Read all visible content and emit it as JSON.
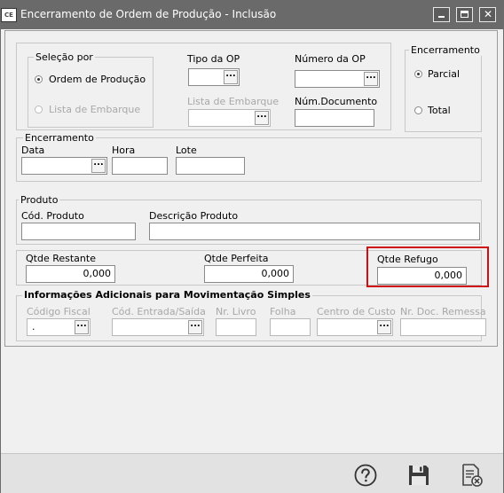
{
  "window": {
    "app_icon": "CE",
    "title": "Encerramento de Ordem de Produção - Inclusão",
    "icons": [
      "minimize-icon",
      "maximize-icon",
      "close-icon"
    ]
  },
  "selecao": {
    "title": "Seleção por",
    "options": [
      "Ordem de Produção",
      "Lista de Embarque"
    ],
    "selected": "Ordem de Produção"
  },
  "tipo_op": {
    "label": "Tipo da OP",
    "value": ""
  },
  "numero_op": {
    "label": "Número da OP",
    "value": ""
  },
  "lista_embarque": {
    "label": "Lista de Embarque",
    "value": ""
  },
  "num_documento": {
    "label": "Núm.Documento",
    "value": ""
  },
  "encerramento_tipo": {
    "title": "Encerramento",
    "options": [
      "Parcial",
      "Total"
    ],
    "selected": "Parcial"
  },
  "encerramento": {
    "title": "Encerramento",
    "data_label": "Data",
    "hora_label": "Hora",
    "lote_label": "Lote"
  },
  "produto": {
    "title": "Produto",
    "codigo_label": "Cód. Produto",
    "descricao_label": "Descrição Produto"
  },
  "quantidades": {
    "restante_label": "Qtde Restante",
    "restante_value": "0,000",
    "perfeita_label": "Qtde Perfeita",
    "perfeita_value": "0,000",
    "refugo_label": "Qtde Refugo",
    "refugo_value": "0,000"
  },
  "info_adicionais": {
    "title": "Informações Adicionais para Movimentação Simples",
    "codigo_fiscal_label": "Código Fiscal",
    "codigo_fiscal_value": ".",
    "cod_entrada_label": "Cód. Entrada/Saída",
    "nr_livro_label": "Nr. Livro",
    "folha_label": "Folha",
    "centro_custo_label": "Centro de Custo",
    "nr_doc_remessa_label": "Nr. Doc. Remessa"
  },
  "footer": {
    "icons": [
      "help-icon",
      "save-icon",
      "cancel-document-icon"
    ]
  },
  "colors": {
    "titlebar": "#6a6a6a",
    "highlight": "#d01010",
    "background": "#f0f0f0"
  }
}
